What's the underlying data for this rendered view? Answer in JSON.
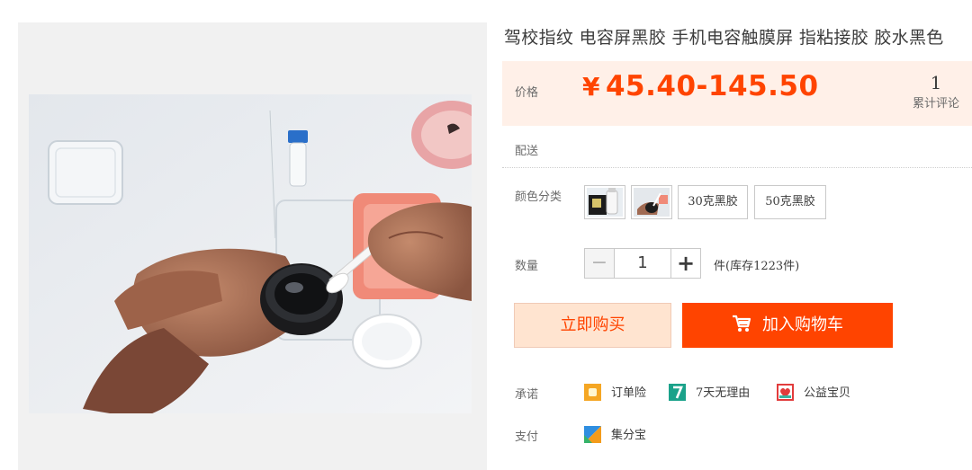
{
  "product": {
    "title": "驾校指纹 电容屏黑胶 手机电容触膜屏 指粘接胶 胶水黑色"
  },
  "price": {
    "label": "价格",
    "currency": "¥",
    "range": "45.40-145.50",
    "accent_color": "#ff4400"
  },
  "reviews": {
    "count": "1",
    "label": "累计评论"
  },
  "shipping": {
    "label": "配送"
  },
  "color_options": {
    "label": "颜色分类",
    "options": [
      {
        "type": "image",
        "icon": "product-thumb-bottles-icon"
      },
      {
        "type": "image",
        "icon": "product-thumb-application-icon"
      },
      {
        "type": "text",
        "label": "30克黑胶"
      },
      {
        "type": "text",
        "label": "50克黑胶"
      }
    ]
  },
  "quantity": {
    "label": "数量",
    "value": "1",
    "minus": "−",
    "plus": "+",
    "stock": "件(库存1223件)"
  },
  "actions": {
    "buy_now": "立即购买",
    "add_to_cart": "加入购物车"
  },
  "promises": {
    "label": "承诺",
    "items": [
      {
        "icon": "order-insurance-icon",
        "label": "订单险",
        "color": "#f5a623"
      },
      {
        "icon": "seven-day-return-icon",
        "label": "7天无理由",
        "color": "#1aa28a"
      },
      {
        "icon": "charity-heart-icon",
        "label": "公益宝贝",
        "color": "#e23c3c"
      }
    ]
  },
  "payment": {
    "label": "支付",
    "items": [
      {
        "icon": "jifenbao-icon",
        "label": "集分宝"
      }
    ]
  }
}
